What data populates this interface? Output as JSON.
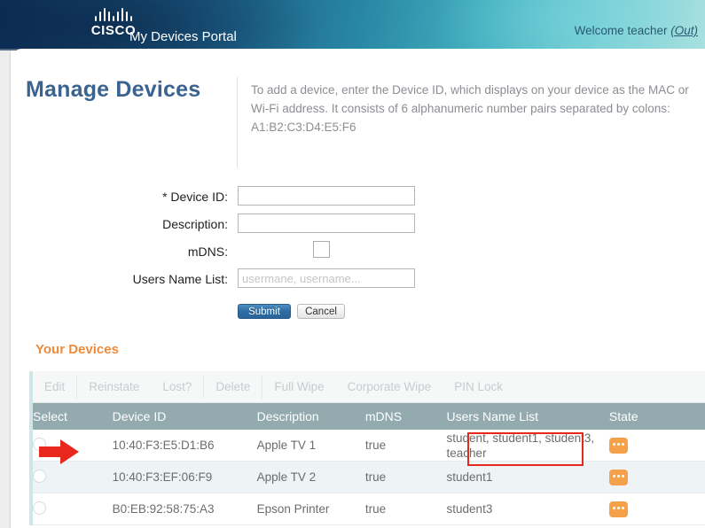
{
  "header": {
    "brand": "CISCO",
    "portal_title": "My Devices Portal",
    "welcome_text": "Welcome teacher ",
    "logout_label": "(Out)",
    "brand_gradient_start": "#0d3058",
    "brand_gradient_end": "#a8e0e0"
  },
  "page": {
    "title": "Manage Devices",
    "intro": "To add a device, enter the Device ID, which displays on your device as the MAC or Wi-Fi address.  It consists of 6 alphanumeric number pairs separated by colons: A1:B2:C3:D4:E5:F6",
    "title_color": "#3a6390"
  },
  "form": {
    "device_id": {
      "label": "* Device ID:",
      "value": "",
      "placeholder": ""
    },
    "description": {
      "label": "Description:",
      "value": "",
      "placeholder": ""
    },
    "mdns": {
      "label": "mDNS:",
      "checked": false
    },
    "users_name_list": {
      "label": "Users Name List:",
      "value": "",
      "placeholder": "usermane, username..."
    },
    "submit_label": "Submit",
    "cancel_label": "Cancel"
  },
  "devices_section": {
    "title": "Your Devices",
    "title_color": "#ee8b3a",
    "toolbar": [
      {
        "label": "Edit",
        "enabled": false,
        "divider_after": true
      },
      {
        "label": "Reinstate",
        "enabled": false,
        "divider_after": false
      },
      {
        "label": "Lost?",
        "enabled": false,
        "divider_after": true
      },
      {
        "label": "Delete",
        "enabled": false,
        "divider_after": true
      },
      {
        "label": "Full Wipe",
        "enabled": false,
        "divider_after": false
      },
      {
        "label": "Corporate Wipe",
        "enabled": false,
        "divider_after": false
      },
      {
        "label": "PIN Lock",
        "enabled": false,
        "divider_after": false
      }
    ],
    "columns": [
      "Select",
      "Device ID",
      "Description",
      "mDNS",
      "Users Name List",
      "State"
    ],
    "rows": [
      {
        "selected": false,
        "device_id": "10:40:F3:E5:D1:B6",
        "description": "Apple TV 1",
        "mdns": "true",
        "users": "student, student1, student3, teacher",
        "state_icon": "ellipsis-badge-icon"
      },
      {
        "selected": false,
        "device_id": "10:40:F3:EF:06:F9",
        "description": "Apple TV 2",
        "mdns": "true",
        "users": "student1",
        "state_icon": "ellipsis-badge-icon"
      },
      {
        "selected": false,
        "device_id": "B0:EB:92:58:75:A3",
        "description": "Epson Printer",
        "mdns": "true",
        "users": "student3",
        "state_icon": "ellipsis-badge-icon"
      }
    ],
    "header_bg": "#93aaae",
    "state_badge_color": "#f5a04a"
  },
  "annotations": {
    "arrow_color": "#e8271d",
    "highlight_box_color": "#e8271d"
  }
}
